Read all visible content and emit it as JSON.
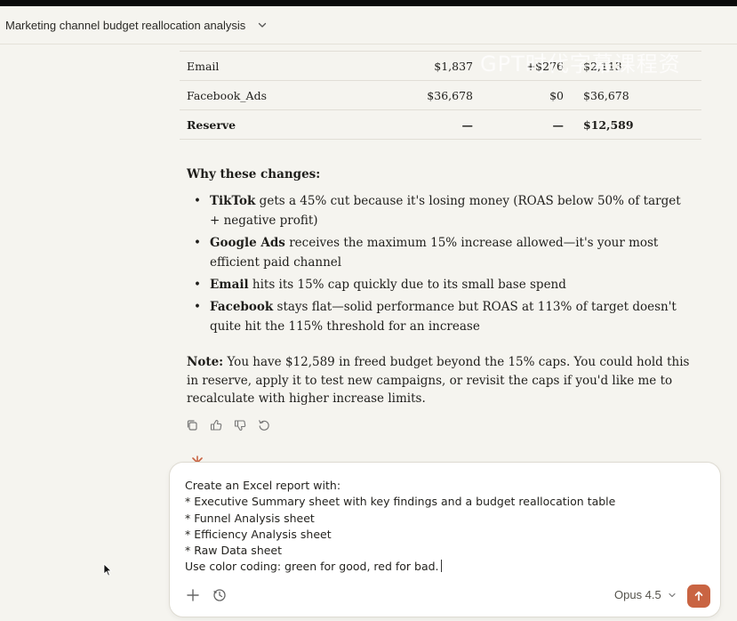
{
  "header": {
    "title": "Marketing channel budget reallocation analysis"
  },
  "watermark": "GPT时代字幕课程资",
  "table": {
    "rows": [
      {
        "channel": "Email",
        "current": "$1,837",
        "change": "+$276",
        "new": "$2,113",
        "bold": false
      },
      {
        "channel": "Facebook_Ads",
        "current": "$36,678",
        "change": "$0",
        "new": "$36,678",
        "bold": false
      },
      {
        "channel": "Reserve",
        "current": "—",
        "change": "—",
        "new": "$12,589",
        "bold": true
      }
    ]
  },
  "why": {
    "heading": "Why these changes:",
    "items": [
      {
        "bold": "TikTok",
        "text": " gets a 45% cut because it's losing money (ROAS below 50% of target + negative profit)"
      },
      {
        "bold": "Google Ads",
        "text": " receives the maximum 15% increase allowed—it's your most efficient paid channel"
      },
      {
        "bold": "Email",
        "text": " hits its 15% cap quickly due to its small base spend"
      },
      {
        "bold": "Facebook",
        "text": " stays flat—solid performance but ROAS at 113% of target doesn't quite hit the 115% threshold for an increase"
      }
    ]
  },
  "note": {
    "label": "Note:",
    "text": " You have $12,589 in freed budget beyond the 15% caps. You could hold this in reserve, apply it to test new campaigns, or revisit the caps if you'd like me to recalculate with higher increase limits."
  },
  "composer": {
    "lines": [
      "Create an Excel report with:",
      "* Executive Summary sheet with key findings and a budget reallocation table",
      "* Funnel Analysis sheet",
      "* Efficiency Analysis sheet",
      "* Raw Data sheet",
      "Use color coding: green for good, red for bad."
    ],
    "model_label": "Opus 4.5"
  },
  "icons": {
    "copy": "copy-icon",
    "thumbs_up": "thumbs-up-icon",
    "thumbs_down": "thumbs-down-icon",
    "retry": "retry-icon",
    "plus": "plus-icon",
    "clock": "clock-icon",
    "send": "send-arrow-icon"
  },
  "colors": {
    "background": "#f5f4ef",
    "send_button": "#c96442"
  }
}
